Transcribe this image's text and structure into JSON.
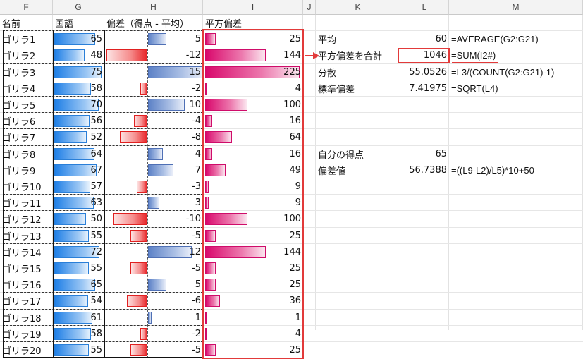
{
  "columns": [
    "F",
    "G",
    "H",
    "I",
    "J",
    "K",
    "L",
    "M"
  ],
  "headers": {
    "name": "名前",
    "kokugo": "国語",
    "hensa": "偏差（得点 - 平均）",
    "heiho": "平方偏差"
  },
  "rows": [
    {
      "name": "ゴリラ1",
      "score": "65",
      "dev": "5",
      "sq": "25"
    },
    {
      "name": "ゴリラ2",
      "score": "48",
      "dev": "-12",
      "sq": "144"
    },
    {
      "name": "ゴリラ3",
      "score": "75",
      "dev": "15",
      "sq": "225"
    },
    {
      "name": "ゴリラ4",
      "score": "58",
      "dev": "-2",
      "sq": "4"
    },
    {
      "name": "ゴリラ5",
      "score": "70",
      "dev": "10",
      "sq": "100"
    },
    {
      "name": "ゴリラ6",
      "score": "56",
      "dev": "-4",
      "sq": "16"
    },
    {
      "name": "ゴリラ7",
      "score": "52",
      "dev": "-8",
      "sq": "64"
    },
    {
      "name": "ゴリラ8",
      "score": "64",
      "dev": "4",
      "sq": "16"
    },
    {
      "name": "ゴリラ9",
      "score": "67",
      "dev": "7",
      "sq": "49"
    },
    {
      "name": "ゴリラ10",
      "score": "57",
      "dev": "-3",
      "sq": "9"
    },
    {
      "name": "ゴリラ11",
      "score": "63",
      "dev": "3",
      "sq": "9"
    },
    {
      "name": "ゴリラ12",
      "score": "50",
      "dev": "-10",
      "sq": "100"
    },
    {
      "name": "ゴリラ13",
      "score": "55",
      "dev": "-5",
      "sq": "25"
    },
    {
      "name": "ゴリラ14",
      "score": "72",
      "dev": "12",
      "sq": "144"
    },
    {
      "name": "ゴリラ15",
      "score": "55",
      "dev": "-5",
      "sq": "25"
    },
    {
      "name": "ゴリラ16",
      "score": "65",
      "dev": "5",
      "sq": "25"
    },
    {
      "name": "ゴリラ17",
      "score": "54",
      "dev": "-6",
      "sq": "36"
    },
    {
      "name": "ゴリラ18",
      "score": "61",
      "dev": "1",
      "sq": "1"
    },
    {
      "name": "ゴリラ19",
      "score": "58",
      "dev": "-2",
      "sq": "4"
    },
    {
      "name": "ゴリラ20",
      "score": "55",
      "dev": "-5",
      "sq": "25"
    }
  ],
  "stats": [
    {
      "label": "平均",
      "value": "60",
      "formula": "=AVERAGE(G2:G21)"
    },
    {
      "label": "平方偏差を合計",
      "value": "1046",
      "formula": "=SUM(I2#)"
    },
    {
      "label": "分散",
      "value": "55.0526",
      "formula": "=L3/(COUNT(G2:G21)-1)"
    },
    {
      "label": "標準偏差",
      "value": "7.41975",
      "formula": "=SQRT(L4)"
    }
  ],
  "score": {
    "label": "自分の得点",
    "value": "65"
  },
  "hensachi": {
    "label": "偏差値",
    "value": "56.7388",
    "formula": "=((L9-L2)/L5)*10+50"
  },
  "colors": {
    "accent_red": "#e23a3a",
    "bar_blue": "#1f7fe6",
    "bar_neg": "#e8262a",
    "bar_pos": "#5d82c7",
    "bar_mag": "#d9086c"
  }
}
